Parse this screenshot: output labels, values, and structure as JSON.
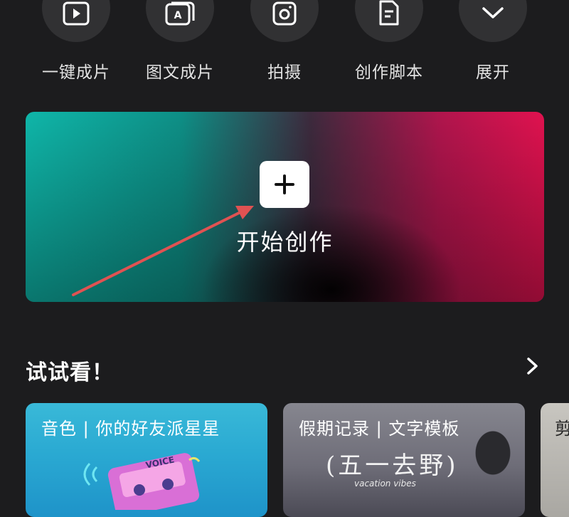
{
  "tools": [
    {
      "label": "一键成片",
      "icon": "play-video-icon"
    },
    {
      "label": "图文成片",
      "icon": "image-text-icon"
    },
    {
      "label": "拍摄",
      "icon": "camera-icon"
    },
    {
      "label": "创作脚本",
      "icon": "script-doc-icon"
    },
    {
      "label": "展开",
      "icon": "chevron-down-icon"
    }
  ],
  "hero": {
    "title": "开始创作",
    "button_icon": "plus-icon",
    "colors": {
      "left": "#0fb6a9",
      "right": "#e0124f"
    }
  },
  "section": {
    "title": "试试看！",
    "more_icon": "chevron-right-icon"
  },
  "cards": [
    {
      "title": "音色 | 你的好友派星星",
      "badge": "VOICE"
    },
    {
      "title": "假期记录 | 文字模板",
      "calligraphy": "(五一去野)",
      "subtitle": "vacation vibes"
    },
    {
      "title": "剪"
    }
  ],
  "annotation": {
    "color": "#e05252"
  }
}
